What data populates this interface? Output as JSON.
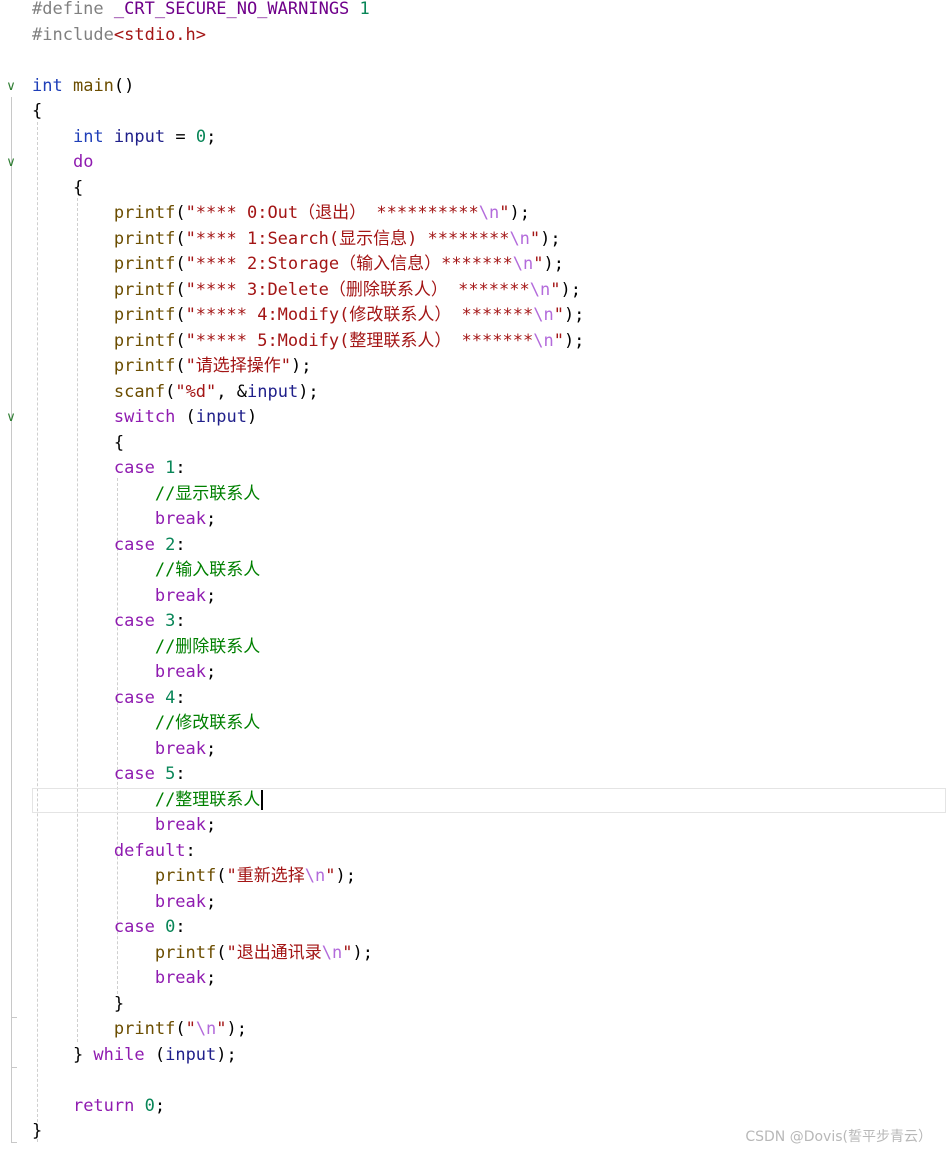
{
  "editor": {
    "lines": [
      {
        "fold": "",
        "tokens": [
          [
            "pp",
            "#define "
          ],
          [
            "macro",
            "_CRT_SECURE_NO_WARNINGS"
          ],
          [
            "txt",
            " "
          ],
          [
            "num",
            "1"
          ]
        ]
      },
      {
        "fold": "",
        "tokens": [
          [
            "pp",
            "#include"
          ],
          [
            "str",
            "<stdio.h>"
          ]
        ]
      },
      {
        "fold": "",
        "tokens": []
      },
      {
        "fold": "v",
        "tokens": [
          [
            "kw",
            "int"
          ],
          [
            "txt",
            " "
          ],
          [
            "fn",
            "main"
          ],
          [
            "txt",
            "()"
          ]
        ]
      },
      {
        "fold": "",
        "tokens": [
          [
            "txt",
            "{"
          ]
        ]
      },
      {
        "fold": "",
        "tokens": [
          [
            "txt",
            "    "
          ],
          [
            "kw",
            "int"
          ],
          [
            "txt",
            " "
          ],
          [
            "var",
            "input"
          ],
          [
            "txt",
            " = "
          ],
          [
            "num",
            "0"
          ],
          [
            "txt",
            ";"
          ]
        ]
      },
      {
        "fold": "v",
        "tokens": [
          [
            "txt",
            "    "
          ],
          [
            "ctl",
            "do"
          ]
        ]
      },
      {
        "fold": "",
        "tokens": [
          [
            "txt",
            "    {"
          ]
        ]
      },
      {
        "fold": "",
        "tokens": [
          [
            "txt",
            "        "
          ],
          [
            "fn",
            "printf"
          ],
          [
            "txt",
            "("
          ],
          [
            "str",
            "\"**** 0:Out（退出） **********"
          ],
          [
            "esc",
            "\\n"
          ],
          [
            "str",
            "\""
          ],
          [
            "txt",
            ");"
          ]
        ]
      },
      {
        "fold": "",
        "tokens": [
          [
            "txt",
            "        "
          ],
          [
            "fn",
            "printf"
          ],
          [
            "txt",
            "("
          ],
          [
            "str",
            "\"**** 1:Search(显示信息) ********"
          ],
          [
            "esc",
            "\\n"
          ],
          [
            "str",
            "\""
          ],
          [
            "txt",
            ");"
          ]
        ]
      },
      {
        "fold": "",
        "tokens": [
          [
            "txt",
            "        "
          ],
          [
            "fn",
            "printf"
          ],
          [
            "txt",
            "("
          ],
          [
            "str",
            "\"**** 2:Storage（输入信息）*******"
          ],
          [
            "esc",
            "\\n"
          ],
          [
            "str",
            "\""
          ],
          [
            "txt",
            ");"
          ]
        ]
      },
      {
        "fold": "",
        "tokens": [
          [
            "txt",
            "        "
          ],
          [
            "fn",
            "printf"
          ],
          [
            "txt",
            "("
          ],
          [
            "str",
            "\"**** 3:Delete（删除联系人） *******"
          ],
          [
            "esc",
            "\\n"
          ],
          [
            "str",
            "\""
          ],
          [
            "txt",
            ");"
          ]
        ]
      },
      {
        "fold": "",
        "tokens": [
          [
            "txt",
            "        "
          ],
          [
            "fn",
            "printf"
          ],
          [
            "txt",
            "("
          ],
          [
            "str",
            "\"***** 4:Modify(修改联系人） *******"
          ],
          [
            "esc",
            "\\n"
          ],
          [
            "str",
            "\""
          ],
          [
            "txt",
            ");"
          ]
        ]
      },
      {
        "fold": "",
        "tokens": [
          [
            "txt",
            "        "
          ],
          [
            "fn",
            "printf"
          ],
          [
            "txt",
            "("
          ],
          [
            "str",
            "\"***** 5:Modify(整理联系人） *******"
          ],
          [
            "esc",
            "\\n"
          ],
          [
            "str",
            "\""
          ],
          [
            "txt",
            ");"
          ]
        ]
      },
      {
        "fold": "",
        "tokens": [
          [
            "txt",
            "        "
          ],
          [
            "fn",
            "printf"
          ],
          [
            "txt",
            "("
          ],
          [
            "str",
            "\"请选择操作\""
          ],
          [
            "txt",
            ");"
          ]
        ]
      },
      {
        "fold": "",
        "tokens": [
          [
            "txt",
            "        "
          ],
          [
            "fn",
            "scanf"
          ],
          [
            "txt",
            "("
          ],
          [
            "str",
            "\"%d\""
          ],
          [
            "txt",
            ", &"
          ],
          [
            "var",
            "input"
          ],
          [
            "txt",
            ");"
          ]
        ]
      },
      {
        "fold": "v",
        "tokens": [
          [
            "txt",
            "        "
          ],
          [
            "ctl",
            "switch"
          ],
          [
            "txt",
            " ("
          ],
          [
            "var",
            "input"
          ],
          [
            "txt",
            ")"
          ]
        ]
      },
      {
        "fold": "",
        "tokens": [
          [
            "txt",
            "        {"
          ]
        ]
      },
      {
        "fold": "",
        "tokens": [
          [
            "txt",
            "        "
          ],
          [
            "ctl",
            "case"
          ],
          [
            "txt",
            " "
          ],
          [
            "num",
            "1"
          ],
          [
            "txt",
            ":"
          ]
        ]
      },
      {
        "fold": "",
        "tokens": [
          [
            "txt",
            "            "
          ],
          [
            "com",
            "//显示联系人"
          ]
        ]
      },
      {
        "fold": "",
        "tokens": [
          [
            "txt",
            "            "
          ],
          [
            "ctl",
            "break"
          ],
          [
            "txt",
            ";"
          ]
        ]
      },
      {
        "fold": "",
        "tokens": [
          [
            "txt",
            "        "
          ],
          [
            "ctl",
            "case"
          ],
          [
            "txt",
            " "
          ],
          [
            "num",
            "2"
          ],
          [
            "txt",
            ":"
          ]
        ]
      },
      {
        "fold": "",
        "tokens": [
          [
            "txt",
            "            "
          ],
          [
            "com",
            "//输入联系人"
          ]
        ]
      },
      {
        "fold": "",
        "tokens": [
          [
            "txt",
            "            "
          ],
          [
            "ctl",
            "break"
          ],
          [
            "txt",
            ";"
          ]
        ]
      },
      {
        "fold": "",
        "tokens": [
          [
            "txt",
            "        "
          ],
          [
            "ctl",
            "case"
          ],
          [
            "txt",
            " "
          ],
          [
            "num",
            "3"
          ],
          [
            "txt",
            ":"
          ]
        ]
      },
      {
        "fold": "",
        "tokens": [
          [
            "txt",
            "            "
          ],
          [
            "com",
            "//删除联系人"
          ]
        ]
      },
      {
        "fold": "",
        "tokens": [
          [
            "txt",
            "            "
          ],
          [
            "ctl",
            "break"
          ],
          [
            "txt",
            ";"
          ]
        ]
      },
      {
        "fold": "",
        "tokens": [
          [
            "txt",
            "        "
          ],
          [
            "ctl",
            "case"
          ],
          [
            "txt",
            " "
          ],
          [
            "num",
            "4"
          ],
          [
            "txt",
            ":"
          ]
        ]
      },
      {
        "fold": "",
        "tokens": [
          [
            "txt",
            "            "
          ],
          [
            "com",
            "//修改联系人"
          ]
        ]
      },
      {
        "fold": "",
        "tokens": [
          [
            "txt",
            "            "
          ],
          [
            "ctl",
            "break"
          ],
          [
            "txt",
            ";"
          ]
        ]
      },
      {
        "fold": "",
        "tokens": [
          [
            "txt",
            "        "
          ],
          [
            "ctl",
            "case"
          ],
          [
            "txt",
            " "
          ],
          [
            "num",
            "5"
          ],
          [
            "txt",
            ":"
          ]
        ]
      },
      {
        "fold": "",
        "current": true,
        "tokens": [
          [
            "txt",
            "            "
          ],
          [
            "com",
            "//整理联系人"
          ]
        ]
      },
      {
        "fold": "",
        "tokens": [
          [
            "txt",
            "            "
          ],
          [
            "ctl",
            "break"
          ],
          [
            "txt",
            ";"
          ]
        ]
      },
      {
        "fold": "",
        "tokens": [
          [
            "txt",
            "        "
          ],
          [
            "ctl",
            "default"
          ],
          [
            "txt",
            ":"
          ]
        ]
      },
      {
        "fold": "",
        "tokens": [
          [
            "txt",
            "            "
          ],
          [
            "fn",
            "printf"
          ],
          [
            "txt",
            "("
          ],
          [
            "str",
            "\"重新选择"
          ],
          [
            "esc",
            "\\n"
          ],
          [
            "str",
            "\""
          ],
          [
            "txt",
            ");"
          ]
        ]
      },
      {
        "fold": "",
        "tokens": [
          [
            "txt",
            "            "
          ],
          [
            "ctl",
            "break"
          ],
          [
            "txt",
            ";"
          ]
        ]
      },
      {
        "fold": "",
        "tokens": [
          [
            "txt",
            "        "
          ],
          [
            "ctl",
            "case"
          ],
          [
            "txt",
            " "
          ],
          [
            "num",
            "0"
          ],
          [
            "txt",
            ":"
          ]
        ]
      },
      {
        "fold": "",
        "tokens": [
          [
            "txt",
            "            "
          ],
          [
            "fn",
            "printf"
          ],
          [
            "txt",
            "("
          ],
          [
            "str",
            "\"退出通讯录"
          ],
          [
            "esc",
            "\\n"
          ],
          [
            "str",
            "\""
          ],
          [
            "txt",
            ");"
          ]
        ]
      },
      {
        "fold": "",
        "tokens": [
          [
            "txt",
            "            "
          ],
          [
            "ctl",
            "break"
          ],
          [
            "txt",
            ";"
          ]
        ]
      },
      {
        "fold": "",
        "tokens": [
          [
            "txt",
            "        }"
          ]
        ]
      },
      {
        "fold": "",
        "tokens": [
          [
            "txt",
            "        "
          ],
          [
            "fn",
            "printf"
          ],
          [
            "txt",
            "("
          ],
          [
            "str",
            "\""
          ],
          [
            "esc",
            "\\n"
          ],
          [
            "str",
            "\""
          ],
          [
            "txt",
            ");"
          ]
        ]
      },
      {
        "fold": "",
        "tokens": [
          [
            "txt",
            "    } "
          ],
          [
            "ctl",
            "while"
          ],
          [
            "txt",
            " ("
          ],
          [
            "var",
            "input"
          ],
          [
            "txt",
            ");"
          ]
        ]
      },
      {
        "fold": "",
        "tokens": []
      },
      {
        "fold": "",
        "tokens": [
          [
            "txt",
            "    "
          ],
          [
            "ctl",
            "return"
          ],
          [
            "txt",
            " "
          ],
          [
            "num",
            "0"
          ],
          [
            "txt",
            ";"
          ]
        ]
      },
      {
        "fold": "",
        "tokens": [
          [
            "txt",
            "}"
          ]
        ]
      }
    ]
  },
  "watermark": "CSDN @Dovis(誓平步青云）",
  "colors": {
    "keyword": "#1f3fb8",
    "control": "#8f1bb0",
    "string": "#a31515",
    "comment": "#008000",
    "number": "#098658",
    "fold_marker": "#2e7d32"
  },
  "icons": {
    "fold": "chevron-down-icon"
  }
}
